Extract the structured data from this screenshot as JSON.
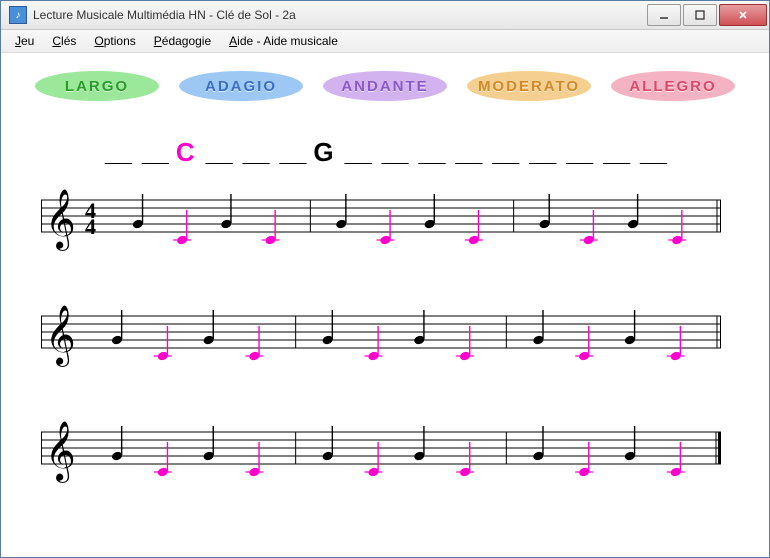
{
  "window": {
    "title": "Lecture Musicale Multimédia HN - Clé de Sol - 2a",
    "icon_label": "♪"
  },
  "menu": {
    "items": [
      {
        "label": "Jeu",
        "accel": "J"
      },
      {
        "label": "Clés",
        "accel": "C"
      },
      {
        "label": "Options",
        "accel": "O"
      },
      {
        "label": "Pédagogie",
        "accel": "P"
      },
      {
        "label": "Aide - Aide musicale",
        "accel": "A"
      }
    ]
  },
  "tempos": [
    {
      "label": "LARGO",
      "bg": "#9be89b",
      "fg": "#2a9b2a"
    },
    {
      "label": "ADAGIO",
      "bg": "#9ec8f4",
      "fg": "#3a6fbf"
    },
    {
      "label": "ANDANTE",
      "bg": "#d3b3ef",
      "fg": "#8a59c6"
    },
    {
      "label": "MODERATO",
      "bg": "#f4cf90",
      "fg": "#d18a2a"
    },
    {
      "label": "ALLEGRO",
      "bg": "#f4b3c3",
      "fg": "#d84a6a"
    }
  ],
  "answer_row": {
    "slots": [
      "_",
      "_",
      "C",
      "_",
      "_",
      "_",
      "G",
      "_",
      "_",
      "_",
      "_",
      "_",
      "_",
      "_",
      "_",
      "_"
    ],
    "highlight_letter": "C"
  },
  "score": {
    "time_signature": "4/4",
    "clef": "treble",
    "note_colors": {
      "normal": "#000000",
      "highlight": "#ff00cc"
    },
    "staves": [
      {
        "show_timesig": true,
        "measures": [
          {
            "notes": [
              {
                "pitch": "G4",
                "hl": false
              },
              {
                "pitch": "C4",
                "hl": true
              },
              {
                "pitch": "G4",
                "hl": false
              },
              {
                "pitch": "C4",
                "hl": true
              }
            ]
          },
          {
            "notes": [
              {
                "pitch": "G4",
                "hl": false
              },
              {
                "pitch": "C4",
                "hl": true
              },
              {
                "pitch": "G4",
                "hl": false
              },
              {
                "pitch": "C4",
                "hl": true
              }
            ]
          },
          {
            "notes": [
              {
                "pitch": "G4",
                "hl": false
              },
              {
                "pitch": "C4",
                "hl": true
              },
              {
                "pitch": "G4",
                "hl": false
              },
              {
                "pitch": "C4",
                "hl": true
              }
            ]
          }
        ]
      },
      {
        "show_timesig": false,
        "measures": [
          {
            "notes": [
              {
                "pitch": "G4",
                "hl": false
              },
              {
                "pitch": "C4",
                "hl": true
              },
              {
                "pitch": "G4",
                "hl": false
              },
              {
                "pitch": "C4",
                "hl": true
              }
            ]
          },
          {
            "notes": [
              {
                "pitch": "G4",
                "hl": false
              },
              {
                "pitch": "C4",
                "hl": true
              },
              {
                "pitch": "G4",
                "hl": false
              },
              {
                "pitch": "C4",
                "hl": true
              }
            ]
          },
          {
            "notes": [
              {
                "pitch": "G4",
                "hl": false
              },
              {
                "pitch": "C4",
                "hl": true
              },
              {
                "pitch": "G4",
                "hl": false
              },
              {
                "pitch": "C4",
                "hl": true
              }
            ]
          }
        ]
      },
      {
        "show_timesig": false,
        "final_bar": true,
        "measures": [
          {
            "notes": [
              {
                "pitch": "G4",
                "hl": false
              },
              {
                "pitch": "C4",
                "hl": true
              },
              {
                "pitch": "G4",
                "hl": false
              },
              {
                "pitch": "C4",
                "hl": true
              }
            ]
          },
          {
            "notes": [
              {
                "pitch": "G4",
                "hl": false
              },
              {
                "pitch": "C4",
                "hl": true
              },
              {
                "pitch": "G4",
                "hl": false
              },
              {
                "pitch": "C4",
                "hl": true
              }
            ]
          },
          {
            "notes": [
              {
                "pitch": "G4",
                "hl": false
              },
              {
                "pitch": "C4",
                "hl": true
              },
              {
                "pitch": "G4",
                "hl": false
              },
              {
                "pitch": "C4",
                "hl": true
              }
            ]
          }
        ]
      }
    ]
  }
}
